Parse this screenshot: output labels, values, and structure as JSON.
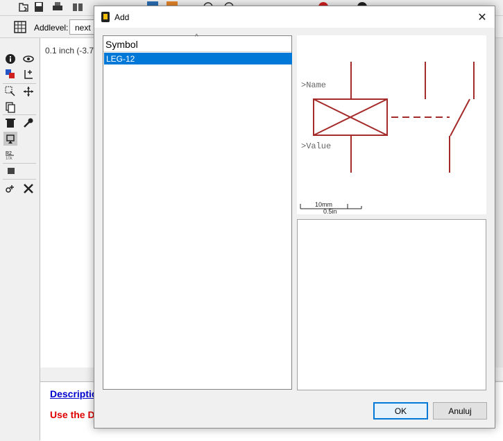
{
  "app": {
    "toolbar_icons": [
      "open-icon",
      "save-icon",
      "print-icon",
      "library-icon",
      "run-icon",
      "script-icon",
      "ulp-icon",
      "zoom-in-icon",
      "zoom-out-icon",
      "stop-icon",
      "help-icon"
    ],
    "addlevel_label": "Addlevel:",
    "addlevel_value": "next",
    "coordinates": "0.1 inch (-3.7",
    "description_link": "Descriptio",
    "description_hint": "Use the D",
    "side_tools": [
      "info-icon",
      "eye-icon",
      "layer-icon",
      "mark-icon",
      "select-icon",
      "move-icon",
      "copy-icon",
      "delete-icon",
      "wrench-icon",
      "add-part-icon",
      "name-icon",
      "attribute-icon",
      "wire-add-icon",
      "x-icon"
    ]
  },
  "dialog": {
    "title": "Add",
    "close_label": "✕",
    "list": {
      "column_header": "Symbol",
      "rows": [
        "LEG-12"
      ],
      "selected_index": 0
    },
    "preview": {
      "name_label": ">Name",
      "value_label": ">Value",
      "scale_metric": "10mm",
      "scale_imperial": "0.5in",
      "symbol_color": "#a52a2a"
    },
    "ok_label": "OK",
    "cancel_label": "Anuluj"
  }
}
